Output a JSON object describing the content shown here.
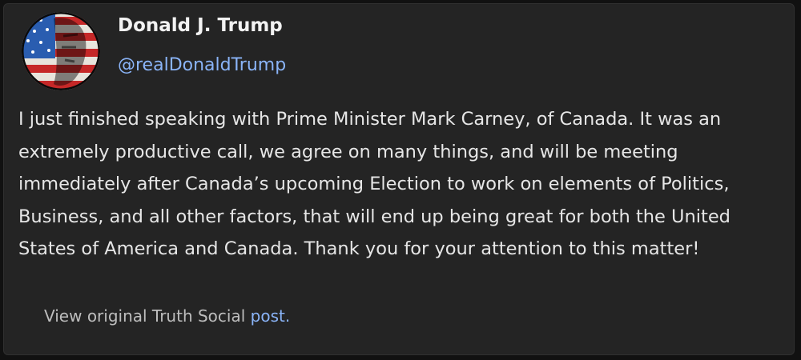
{
  "post": {
    "author_name": "Donald J. Trump",
    "author_handle": "@realDonaldTrump",
    "avatar_icon": "flag-face-avatar",
    "text": "I just finished speaking with Prime Minister Mark Carney, of Canada. It was an extremely productive call, we agree on many things, and will be meeting immediately after Canada’s upcoming Election to work on elements of Politics, Business, and all other factors, that will end up being great for both the United States of America and Canada. Thank you for your attention to this matter!"
  },
  "footer": {
    "prefix": "View original Truth Social ",
    "link_label": "post."
  },
  "colors": {
    "background": "#111111",
    "card": "#242424",
    "text": "#e6e6e6",
    "link": "#8ab4f8",
    "muted": "#bdbdbd"
  }
}
